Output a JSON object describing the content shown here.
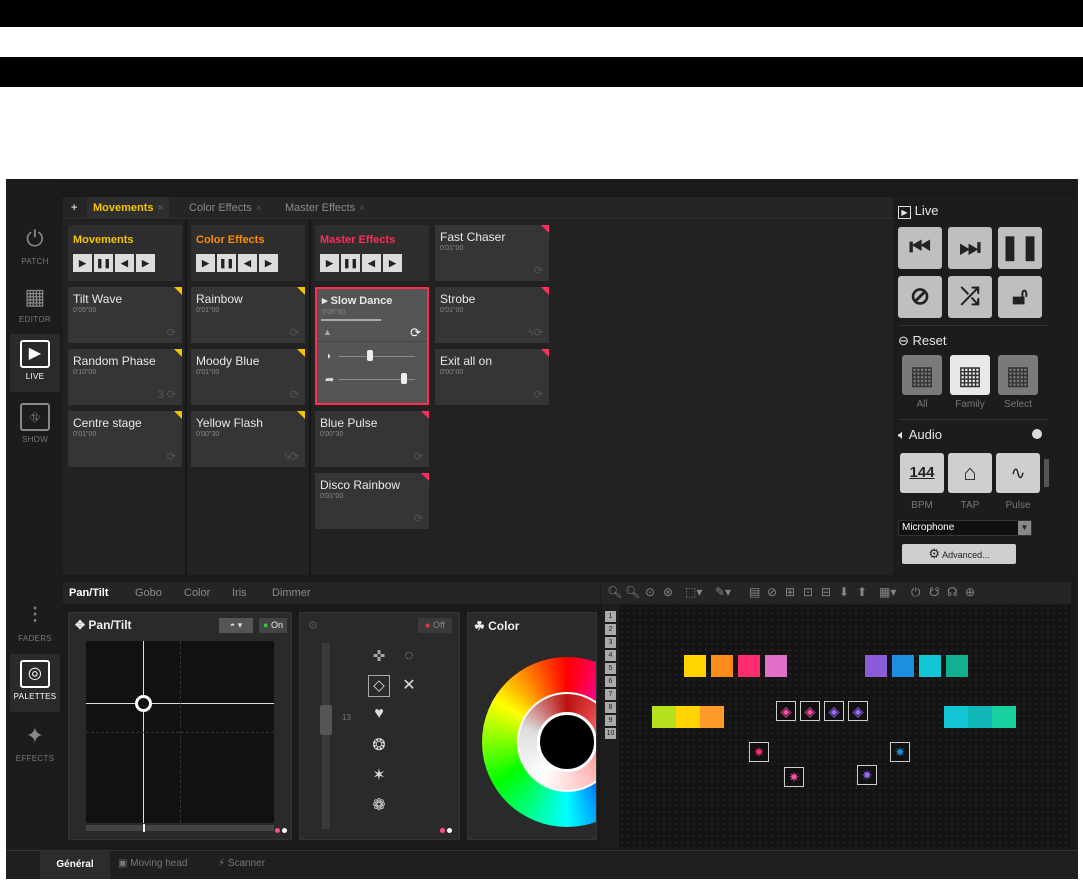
{
  "nav": {
    "top": [
      {
        "label": "PATCH",
        "icon": "patch-icon"
      },
      {
        "label": "EDITOR",
        "icon": "editor-icon"
      },
      {
        "label": "LIVE",
        "icon": "live-icon"
      },
      {
        "label": "SHOW",
        "icon": "show-icon"
      }
    ],
    "bottom": [
      {
        "label": "FADERS",
        "icon": "faders-icon"
      },
      {
        "label": "PALETTES",
        "icon": "palettes-icon"
      },
      {
        "label": "EFFECTS",
        "icon": "effects-icon"
      }
    ]
  },
  "top_tabs": {
    "add": "+",
    "items": [
      {
        "label": "Movements"
      },
      {
        "label": "Color Effects"
      },
      {
        "label": "Master Effects"
      }
    ],
    "close": "×"
  },
  "columns": [
    {
      "title": "Movements",
      "color": "#f5c400"
    },
    {
      "title": "Color Effects",
      "color": "#ff8c00"
    },
    {
      "title": "Master Effects",
      "color": "#ff2d55"
    }
  ],
  "cells": [
    {
      "name": "Tilt Wave",
      "time": "0'05\"00"
    },
    {
      "name": "Random Phase",
      "time": "0'10\"00",
      "left": "",
      "right": "3"
    },
    {
      "name": "Centre stage",
      "time": "0'01\"00"
    },
    {
      "name": "Rainbow",
      "time": "0'01\"00"
    },
    {
      "name": "Moody Blue",
      "time": "0'01\"00"
    },
    {
      "name": "Yellow Flash",
      "time": "0'00\"30"
    },
    {
      "name": "Slow Dance",
      "time": "0'05\"00"
    },
    {
      "name": "Blue Pulse",
      "time": "0'00\"30"
    },
    {
      "name": "Disco Rainbow",
      "time": "0'01\"00"
    },
    {
      "name": "Fast Chaser",
      "time": "0'01\"00"
    },
    {
      "name": "Strobe",
      "time": "0'01\"00"
    },
    {
      "name": "Exit all on",
      "time": "0'00\"00"
    }
  ],
  "right": {
    "live_label": "Live",
    "reset_label": "Reset",
    "reset_options": [
      "All",
      "Family",
      "Select"
    ],
    "audio_label": "Audio",
    "audio_options": [
      "BPM",
      "TAP",
      "Pulse"
    ],
    "bpm_value": "144",
    "input_source": "Microphone",
    "advanced_label": "Advanced..."
  },
  "bottom_tabs": [
    "Pan/Tilt",
    "Gobo",
    "Color",
    "Iris",
    "Dimmer"
  ],
  "pantilt": {
    "title": "Pan/Tilt",
    "on_label": "On"
  },
  "gobo_panel": {
    "off_label": "Off",
    "value": "13"
  },
  "color_panel": {
    "title": "Color"
  },
  "footer_tabs": [
    "Général",
    "Moving head",
    "Scanner"
  ],
  "palette_numbers": [
    "1",
    "2",
    "3",
    "4",
    "5",
    "6",
    "7",
    "8",
    "9",
    "10"
  ],
  "swatches": {
    "row1": [
      "#ffd400",
      "#ff8c1a",
      "#ff2d6e",
      "#e070c8",
      "#8a5cd6",
      "#1e8fe0",
      "#12c6d6",
      "#10b090"
    ],
    "row2": [
      "#b6e01c",
      "#ffd400",
      "#ff9a2a",
      "#12c6d6",
      "#10b5b5",
      "#18d0a0"
    ]
  }
}
